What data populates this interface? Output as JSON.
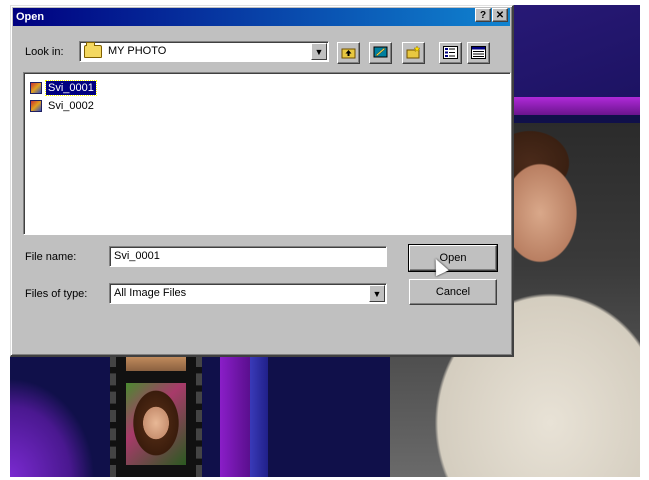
{
  "dialog": {
    "title": "Open",
    "help_button": "?",
    "close_button": "✕",
    "look_in_label": "Look in:",
    "look_in_value": "MY PHOTO",
    "toolbar": {
      "up_folder_icon": "up-folder-icon",
      "desktop_icon": "desktop-icon",
      "new_folder_icon": "new-folder-icon",
      "list_view_icon": "list-view-icon",
      "details_view_icon": "details-view-icon"
    },
    "files": [
      {
        "name": "Svi_0001",
        "selected": true
      },
      {
        "name": "Svi_0002",
        "selected": false
      }
    ],
    "file_name_label": "File name:",
    "file_name_value": "Svi_0001",
    "files_of_type_label": "Files of type:",
    "files_of_type_value": "All Image Files",
    "open_button": "Open",
    "cancel_button": "Cancel"
  }
}
